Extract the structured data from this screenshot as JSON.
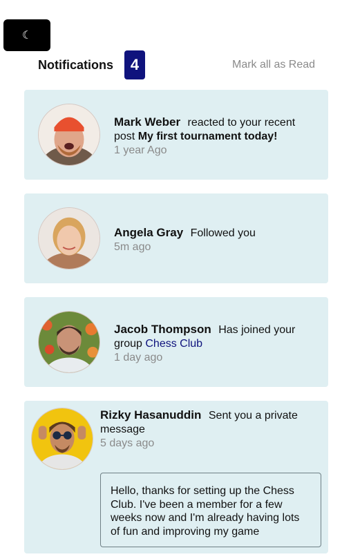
{
  "theme_toggle": {
    "icon": "moon-icon",
    "glyph": "☾"
  },
  "header": {
    "title": "Notifications",
    "unread_count": "4",
    "mark_all_label": "Mark all as Read"
  },
  "colors": {
    "card_bg": "#dfeff2",
    "badge_bg": "#0f137d",
    "link": "#0f137d",
    "muted": "#8a8a8a"
  },
  "notifications": [
    {
      "name": "Mark Weber",
      "action": "reacted to your recent post",
      "target": "My first tournament today!",
      "time": "1 year Ago"
    },
    {
      "name": "Angela Gray",
      "action": "Followed you",
      "time": "5m ago"
    },
    {
      "name": "Jacob Thompson",
      "action": "Has joined your group",
      "target": "Chess Club",
      "time": "1 day ago"
    },
    {
      "name": "Rizky Hasanuddin",
      "action": "Sent you a private message",
      "time": "5 days ago",
      "message": "Hello, thanks for setting up the Chess Club. I've been a member for a few weeks now and I'm already having lots of fun and improving my game"
    }
  ]
}
